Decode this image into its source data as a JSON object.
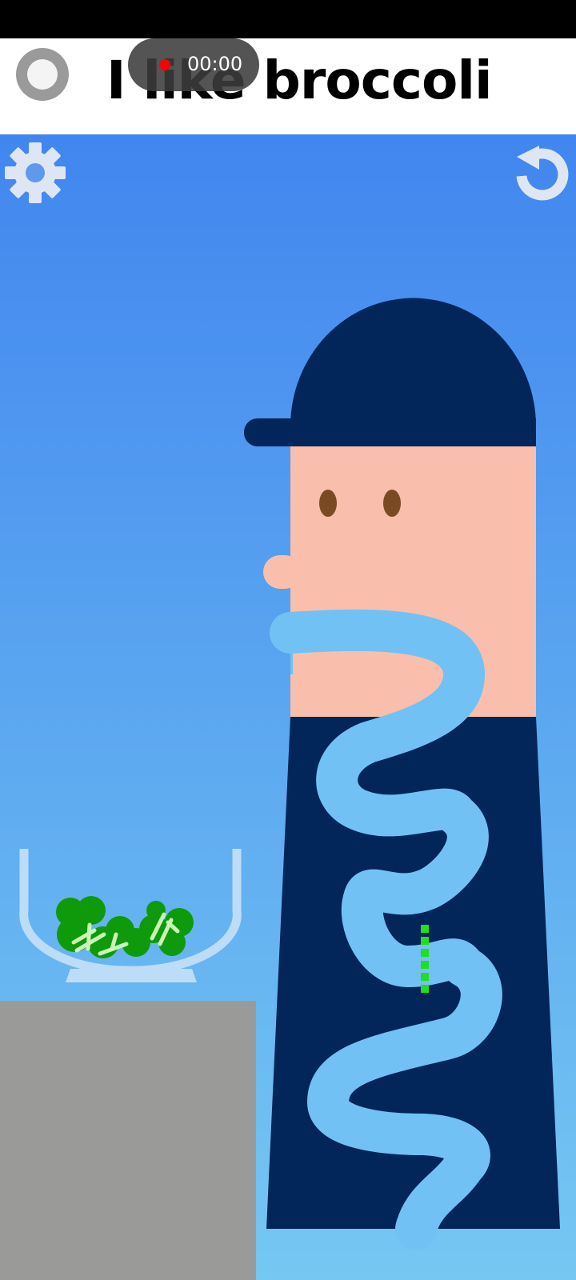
{
  "header": {
    "title": "I like broccoli"
  },
  "recording": {
    "timer": "00:00"
  },
  "icons": {
    "record": "record-toggle-icon",
    "settings": "gear-icon",
    "restart": "restart-arrow-icon"
  },
  "colors": {
    "sky_top": "#4186ef",
    "sky_bottom": "#76c7f2",
    "hat": "#02255a",
    "body": "#02255a",
    "skin": "#f9bfac",
    "eyes": "#7a4a25",
    "intestine": "#72c1f4",
    "table": "#9a9a98",
    "broccoli": "#0f9a0c",
    "broccoli_stem": "#c9f5b5",
    "blockage": "#22dd22",
    "bowl": "#bcdcf8",
    "icon": "#dde6f2"
  }
}
